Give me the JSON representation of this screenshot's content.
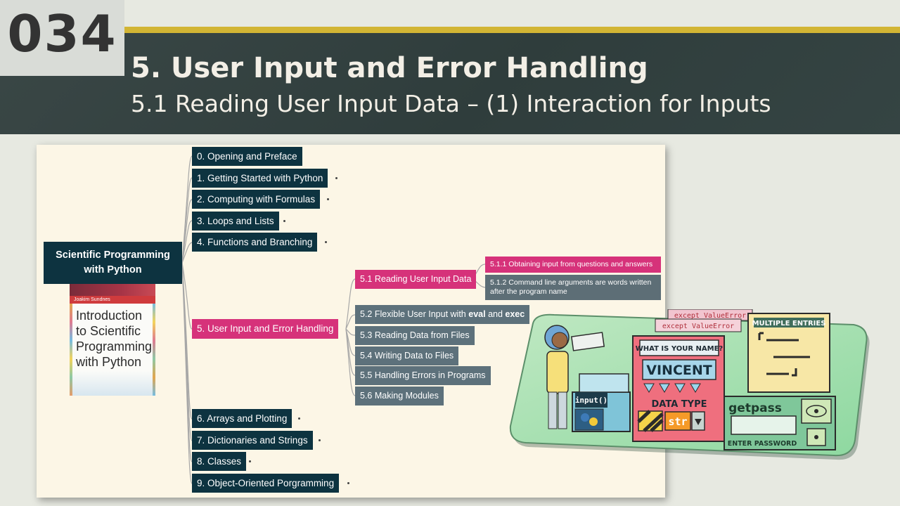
{
  "slide_number": "034",
  "title": "5. User Input and Error Handling",
  "subtitle": "5.1 Reading User Input Data – (1) Interaction for Inputs",
  "colors": {
    "header_band": "#34423f",
    "gold_line": "#d2b534",
    "node_dark": "#0d3340",
    "node_pink": "#d6327a",
    "node_gray": "#5d717b",
    "mindmap_bg": "#fcf6e6"
  },
  "mindmap": {
    "root": {
      "line1": "Scientific Programming",
      "line2": "with Python"
    },
    "book": {
      "author": "Joakim Sundnes",
      "title_lines": [
        "Introduction",
        "to Scientific",
        "Programming",
        "with Python"
      ]
    },
    "chapters": [
      "0. Opening and Preface",
      "1. Getting Started with Python",
      "2. Computing with Formulas",
      "3. Loops and Lists",
      "4. Functions and Branching",
      "5. User Input and Error Handling",
      "6. Arrays and Plotting",
      "7. Dictionaries and Strings",
      "8. Classes",
      "9. Object-Oriented Porgramming"
    ],
    "sections": [
      {
        "pre": "5.1 Reading User Input Data",
        "b1": "",
        "mid": "",
        "b2": ""
      },
      {
        "pre": "5.2 Flexible User Input with ",
        "b1": "eval",
        "mid": " and ",
        "b2": "exec"
      },
      {
        "pre": "5.3 Reading Data from Files",
        "b1": "",
        "mid": "",
        "b2": ""
      },
      {
        "pre": "5.4 Writing Data to Files",
        "b1": "",
        "mid": "",
        "b2": ""
      },
      {
        "pre": "5.5 Handling Errors in Programs",
        "b1": "",
        "mid": "",
        "b2": ""
      },
      {
        "pre": "5.6 Making Modules",
        "b1": "",
        "mid": "",
        "b2": ""
      }
    ],
    "subsections": [
      "5.1.1 Obtaining input from questions and answers",
      "5.1.2 Command line arguments are words written after the program name"
    ]
  },
  "illustration": {
    "except1": "except ValueError",
    "except2": "except ValueError",
    "question": "WHAT IS YOUR NAME?",
    "name": "VINCENT",
    "input_label": "input()",
    "data_type": "DATA TYPE",
    "str_label": "str",
    "multiple_entries": "MULTIPLE ENTRIES",
    "getpass": "getpass",
    "enter_password": "ENTER PASSWORD"
  }
}
